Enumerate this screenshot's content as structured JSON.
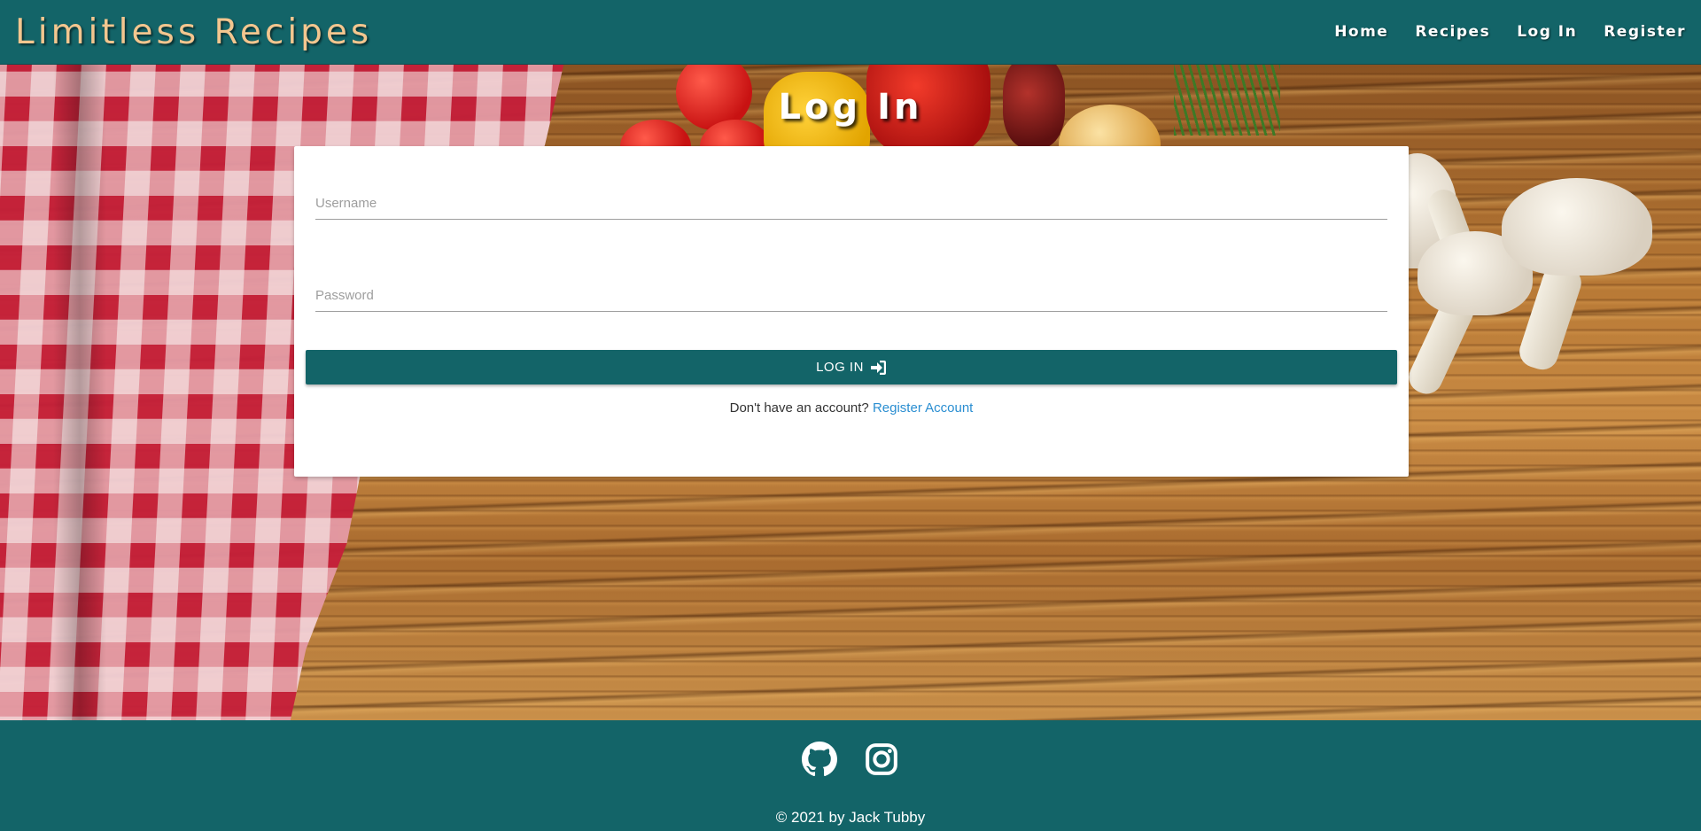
{
  "brand": "Limitless Recipes",
  "nav": {
    "items": [
      {
        "label": "Home"
      },
      {
        "label": "Recipes"
      },
      {
        "label": "Log In"
      },
      {
        "label": "Register"
      }
    ]
  },
  "page": {
    "title": "Log In"
  },
  "form": {
    "username": {
      "placeholder": "Username",
      "value": ""
    },
    "password": {
      "placeholder": "Password",
      "value": ""
    },
    "submit_label": "LOG IN",
    "submit_icon": "sign-in-icon",
    "register_prompt": "Don't have an account?",
    "register_link": "Register Account"
  },
  "footer": {
    "social": [
      {
        "name": "github-icon"
      },
      {
        "name": "instagram-icon"
      }
    ],
    "copyright": "© 2021 by Jack Tubby"
  },
  "colors": {
    "primary": "#136468",
    "brand_text": "#f3c68f",
    "link": "#2a8ed1"
  }
}
